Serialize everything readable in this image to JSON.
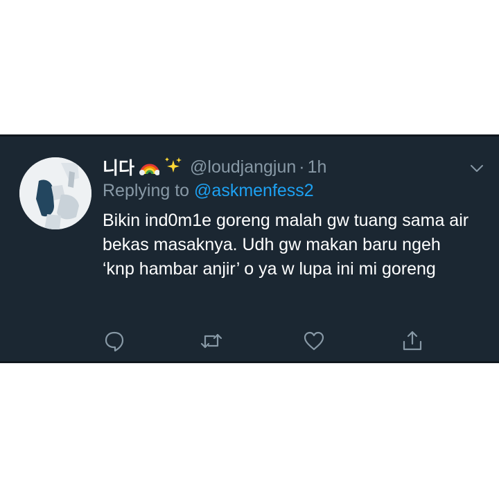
{
  "tweet": {
    "display_name": "니다",
    "emoji": [
      "rainbow-emoji",
      "sparkles-emoji"
    ],
    "handle": "@loudjangjun",
    "separator": "·",
    "time": "1h",
    "replying_label": "Replying to",
    "replying_to": "@askmenfess2",
    "text": "Bikin ind0m1e goreng malah gw tuang sama air bekas masaknya. Udh gw makan baru ngeh ‘knp hambar anjir’ o ya w lupa ini mi goreng"
  },
  "actions": [
    "reply-icon",
    "retweet-icon",
    "like-icon",
    "share-icon"
  ],
  "colors": {
    "background": "#1b2732",
    "text": "#ffffff",
    "muted": "#8899a6",
    "link": "#1da1f2"
  }
}
